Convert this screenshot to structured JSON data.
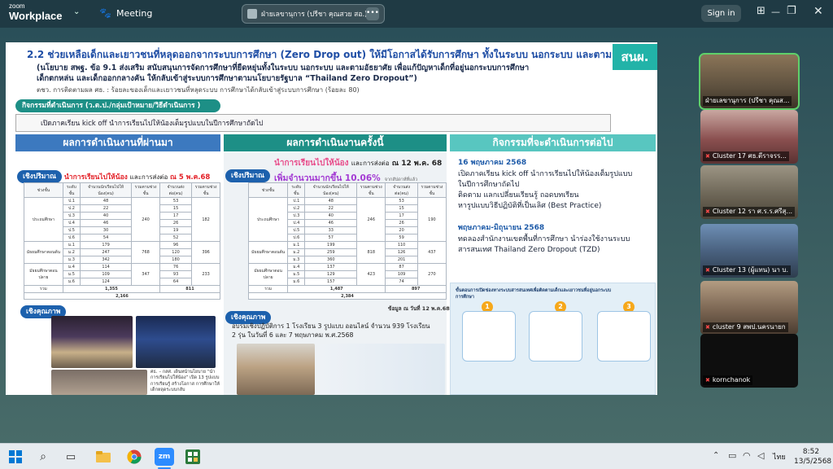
{
  "titlebar": {
    "logo_small": "zoom",
    "logo_big": "Workplace",
    "meeting_label": "Meeting",
    "share_chip_text": "ฝ่ายเลขานุการ (ปรีชา  คุณสวย สอ.)'s s",
    "sign_in": "Sign in",
    "colors": {
      "bar": "#1f3a44",
      "accent": "#22b3a8"
    }
  },
  "slide": {
    "title": "2.2 ช่วยเหลือเด็กและเยาวชนที่หลุดออกจากระบบการศึกษา (Zero Drop out) ให้มีโอกาสได้รับการศึกษา ทั้งในระบบ นอกระบบ และตามอัธยาศัย",
    "sub1": "(นโยบาย สพฐ. ข้อ 9.1 ส่งเสริม สนับสนุนการจัดการศึกษาที่ยืดหยุ่นทั้งในระบบ นอกระบบ และตามอัธยาศัย เพื่อแก้ปัญหาเด็กที่อยู่นอกระบบการศึกษา",
    "sub2": "เด็กตกหล่น และเด็กออกกลางคัน ให้กลับเข้าสู่ระบบการศึกษาตามนโยบายรัฐบาล “Thailand Zero Dropout”)",
    "indicator": "ตชว. การติดตามผล ศธ. : ร้อยละของเด็กและเยาวชนที่หลุดระบบ การศึกษาได้กลับเข้าสู่ระบบการศึกษา (ร้อยละ 80)",
    "badge": "สนผ.",
    "activity_label": "กิจกรรมที่ดำเนินการ (ว.ต.ป./กลุ่มเป้าหมาย/วิธีดำเนินการ )",
    "kickoff_text": "เปิดภาคเรียน kick off นำการเรียนไปให้น้องเต็มรูปแบบในปีการศึกษาถัดไป",
    "headers": {
      "past": "ผลการดำเนินงานที่ผ่านมา",
      "current": "ผลการดำเนินงานครั้งนี้",
      "next": "กิจกรรมที่จะดำเนินการต่อไป"
    },
    "past": {
      "pill_quant": "เชิงปริมาณ",
      "red_title": "นำการเรียนไปให้น้อง",
      "black_title": "และการส่งต่อ",
      "date": "ณ 5 พ.ค.68",
      "pill_qual": "เชิงคุณภาพ",
      "caption": "ศธ. – กสศ. เดินหน้านโยบาย “นำการเรียนไปให้น้อง” เปิด 13 รูปแบบการเรียนรู้ สร้างโอกาส การศึกษาให้เด็กหลุดระบบกลับ"
    },
    "current": {
      "pill_quant": "เชิงปริมาณ",
      "red_title": "นำการเรียนไปให้น้อง",
      "black_title": "และการส่งต่อ",
      "date": "ณ 12 พ.ค. 68",
      "increase": "เพิ่มจำนวนมากขึ้น 10.06%",
      "increase_note": "จากสัปดาห์ที่แล้ว",
      "data_note": "ข้อมูล ณ วันที่ 12 พ.ค.68",
      "pill_qual": "เชิงคุณภาพ",
      "qual_text1": "อบรมเชิงปฏิบัติการ 1 โรงเรียน 3 รูปแบบ ออนไลน์ จำนวน 939 โรงเรียน",
      "qual_text2": "2 รุ่น ในวันที่ 6 และ 7 พฤษภาคม พ.ศ.2568"
    },
    "table_headers": [
      "ช่วงชั้น",
      "ระดับชั้น",
      "จำนวนนักเรียนไปให้น้อง(คน)",
      "รวมตามช่วงชั้น",
      "จำนวนส่งต่อ(คน)",
      "รวมตามช่วงชั้น"
    ],
    "table_groups": [
      "ประถมศึกษา",
      "มัธยมศึกษาตอนต้น",
      "มัธยมศึกษาตอนปลาย"
    ],
    "table_past": {
      "levels": [
        "ป.1",
        "ป.2",
        "ป.3",
        "ป.4",
        "ป.5",
        "ป.6",
        "ม.1",
        "ม.2",
        "ม.3",
        "ม.4",
        "ม.5",
        "ม.6"
      ],
      "learn": [
        "48",
        "22",
        "40",
        "46",
        "30",
        "54",
        "179",
        "247",
        "342",
        "114",
        "109",
        "124"
      ],
      "learn_sums": [
        "240",
        "768",
        "347"
      ],
      "send": [
        "53",
        "15",
        "17",
        "26",
        "19",
        "52",
        "96",
        "120",
        "180",
        "76",
        "93",
        "64"
      ],
      "send_sums": [
        "182",
        "396",
        "233"
      ],
      "totals": [
        "1,355",
        "811"
      ],
      "grand": "2,166",
      "total_label": "รวม"
    },
    "table_current": {
      "levels": [
        "ป.1",
        "ป.2",
        "ป.3",
        "ป.4",
        "ป.5",
        "ป.6",
        "ม.1",
        "ม.2",
        "ม.3",
        "ม.4",
        "ม.5",
        "ม.6"
      ],
      "learn": [
        "48",
        "22",
        "40",
        "46",
        "33",
        "57",
        "199",
        "259",
        "360",
        "137",
        "129",
        "157"
      ],
      "learn_sums": [
        "246",
        "818",
        "423"
      ],
      "send": [
        "53",
        "15",
        "17",
        "26",
        "20",
        "59",
        "110",
        "126",
        "201",
        "87",
        "109",
        "74"
      ],
      "send_sums": [
        "190",
        "437",
        "270"
      ],
      "totals": [
        "1,487",
        "897"
      ],
      "grand": "2,384",
      "total_label": "รวม"
    },
    "next": {
      "date1": "16 พฤษภาคม 2568",
      "line1": "เปิดภาคเรียน kick off นำการเรียนไปให้น้องเต็มรูปแบบ",
      "line2": "ในปีการศึกษาถัดไป",
      "line3": "ติดตาม แลกเปลี่ยนเรียนรู้ ถอดบทเรียน",
      "line4": "หารูปแบบวิธีปฏิบัติที่เป็นเลิศ (Best Practice)",
      "date2": "พฤษภาคม-มิถุนายน 2568",
      "line5": "ทดลองสำนักงานเขตพื้นที่การศึกษา นำร่องใช้งานระบบ",
      "line6": "สารสนเทศ Thailand Zero Dropout (TZD)",
      "info_title": "ขั้นตอนการเปิดช่องทางระบบสารสนเทศเพื่อติดตามเด็กและเยาวชนที่อยู่นอกระบบการศึกษา",
      "steps": [
        "1",
        "2",
        "3"
      ]
    }
  },
  "participants": [
    {
      "name": "ฝ่ายเลขานุการ (ปรีชา  คุณส...",
      "muted": false,
      "bg": "#7a6a52"
    },
    {
      "name": "Cluster 17 ศธ.ตีราจรร...",
      "muted": true,
      "bg": "#8a5a5a"
    },
    {
      "name": "Cluster 12 รา ศ.ร.ร.ศรีสุ...",
      "muted": true,
      "bg": "#6e6a5e"
    },
    {
      "name": "Cluster 13 (ผู้แทน) นา บ.",
      "muted": true,
      "bg": "#5a6a7a"
    },
    {
      "name": "cluster 9 สพป.นครนายก",
      "muted": true,
      "bg": "#84705e"
    },
    {
      "name": "kornchanok",
      "muted": true,
      "bg": "#101010"
    }
  ],
  "taskbar": {
    "time": "8:52",
    "date": "13/5/2568",
    "lang": "ไทย"
  }
}
